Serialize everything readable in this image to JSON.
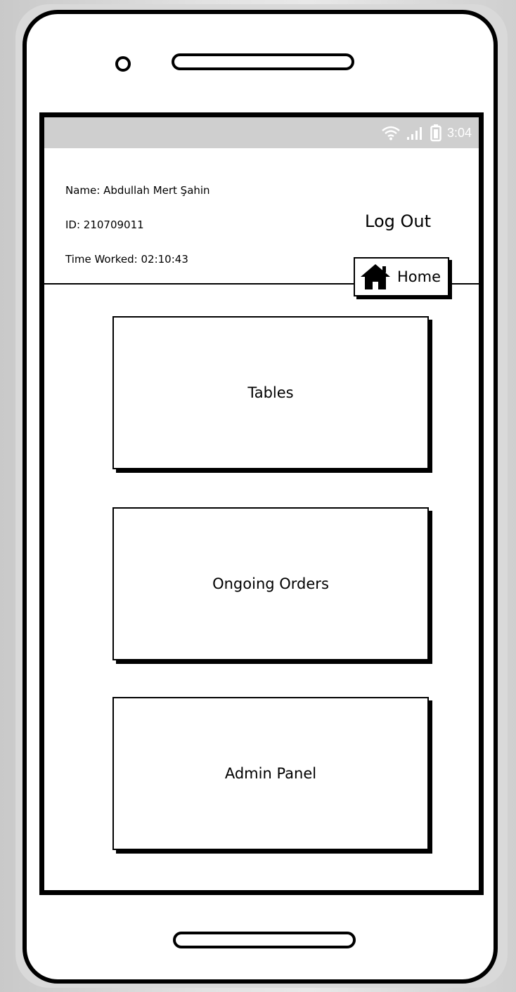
{
  "status_bar": {
    "time": "3:04",
    "icons": [
      "wifi-icon",
      "signal-icon",
      "battery-icon"
    ]
  },
  "header": {
    "name_line": "Name: Abdullah Mert Şahin",
    "id_line": "ID: 210709011",
    "time_worked_line": "Time Worked: 02:10:43",
    "logout_label": "Log Out",
    "home_label": "Home"
  },
  "menu": {
    "tables_label": "Tables",
    "ongoing_orders_label": "Ongoing Orders",
    "admin_panel_label": "Admin Panel"
  },
  "colors": {
    "status_bar_bg": "#cfcfcf",
    "outline": "#000000",
    "screen_bg": "#ffffff"
  }
}
